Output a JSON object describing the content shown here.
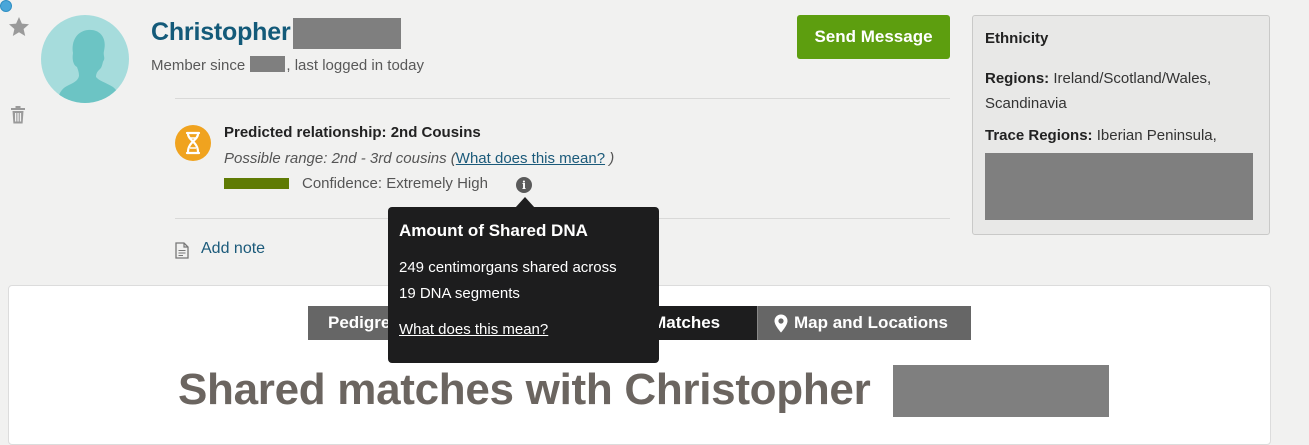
{
  "profile": {
    "name": "Christopher",
    "member_since_prefix": "Member since",
    "member_since_suffix": ", last logged in today"
  },
  "actions": {
    "send_message": "Send Message",
    "add_note": "Add note"
  },
  "relationship": {
    "predicted": "Predicted relationship: 2nd Cousins",
    "range_prefix": "Possible range: 2nd - 3rd cousins (",
    "range_link": "What does this mean?",
    "range_suffix": ")",
    "confidence": "Confidence: Extremely High"
  },
  "tooltip": {
    "title": "Amount of Shared DNA",
    "line1": "249 centimorgans shared across",
    "line2": "19 DNA segments",
    "link": "What does this mean?"
  },
  "ethnicity": {
    "title": "Ethnicity",
    "regions_label": "Regions:",
    "regions_value": "Ireland/Scotland/Wales, Scandinavia",
    "trace_label": "Trace Regions:",
    "trace_value": "Iberian Peninsula,"
  },
  "tabs": {
    "pedigree": "Pedigree",
    "shared_matches": "Shared Matches",
    "shared_matches_visible": "d Matches",
    "map": "Map and Locations"
  },
  "main": {
    "heading": "Shared matches with Christopher"
  },
  "colors": {
    "name": "#135a79",
    "send_button": "#5d9e0f",
    "confidence_bar": "#5f7b04",
    "dna_icon": "#f0a31f",
    "avatar": "#a6dcdc"
  }
}
